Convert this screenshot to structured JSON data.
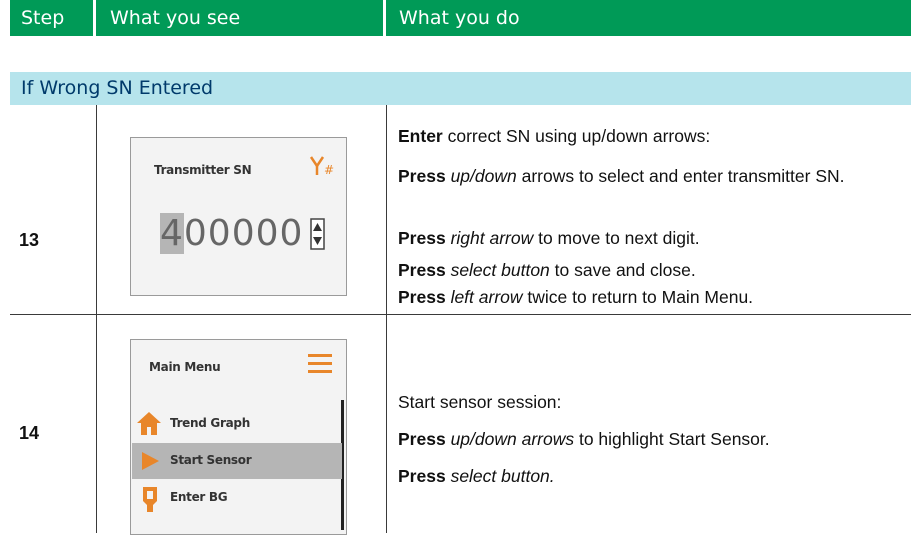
{
  "header": {
    "col_step": "Step",
    "col_see": "What you see",
    "col_do": "What you do"
  },
  "section_title": "If Wrong SN Entered",
  "rows": [
    {
      "step": "13",
      "screen": {
        "title": "Transmitter SN",
        "icon_text": "Y#",
        "digit_highlighted": "4",
        "digits_rest": "00000"
      },
      "instructions": [
        {
          "bold": "Enter",
          "text": " correct SN using up/down arrows:"
        },
        {
          "bold": "Press",
          "italic": "up/down",
          "text": " arrows to select and enter transmitter SN."
        },
        {
          "bold": "Press",
          "italic": "right arrow",
          "text": " to move to next digit."
        },
        {
          "bold": "Press",
          "italic": "select button",
          "text": " to save and close."
        },
        {
          "bold": "Press",
          "italic": "left arrow",
          "text": " twice to return to Main Menu."
        }
      ]
    },
    {
      "step": "14",
      "screen": {
        "title": "Main Menu",
        "items": [
          "Trend Graph",
          "Start Sensor",
          "Enter BG"
        ]
      },
      "instructions": [
        {
          "text": "Start sensor session:"
        },
        {
          "bold": "Press",
          "italic": "up/down arrows",
          "text": " to highlight Start Sensor."
        },
        {
          "bold": "Press",
          "italic": "select button."
        }
      ]
    }
  ],
  "colors": {
    "header_bg": "#009a57",
    "section_bg": "#b6e4ec",
    "section_text": "#003a6b",
    "accent_orange": "#e8862a"
  }
}
